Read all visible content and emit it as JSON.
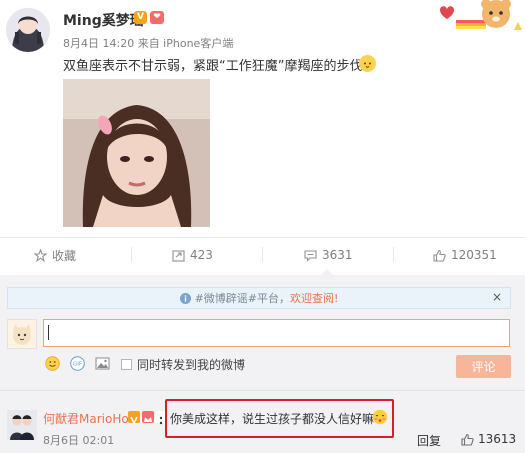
{
  "post": {
    "username": "Ming奚梦瑶",
    "meta": "8月4日 14:20 来自 iPhone客户端",
    "text": "双鱼座表示不甘示弱，紧跟“工作狂魔”摩羯座的步伐！",
    "verified_badge": "V",
    "heart_badge": "❤"
  },
  "actions": {
    "favorite_label": "收藏",
    "repost_count": "423",
    "comment_count": "3631",
    "like_count": "120351"
  },
  "notice": {
    "text": "#微博辟谣#平台，",
    "highlight": "欢迎查阅!",
    "close": "×"
  },
  "composer": {
    "input_value": "",
    "repost_label": "同时转发到我的微博",
    "submit_label": "评论"
  },
  "comment": {
    "username": "何猷君MarioHo",
    "text": "你美成这样，说生过孩子都没人信好嘛",
    "time": "8月6日 02:01",
    "reply_label": "回复",
    "like_count": "13613"
  },
  "colors": {
    "accent": "#eb7350",
    "highlight_box": "#d91e2e",
    "submit_bg": "#f7b69a"
  }
}
